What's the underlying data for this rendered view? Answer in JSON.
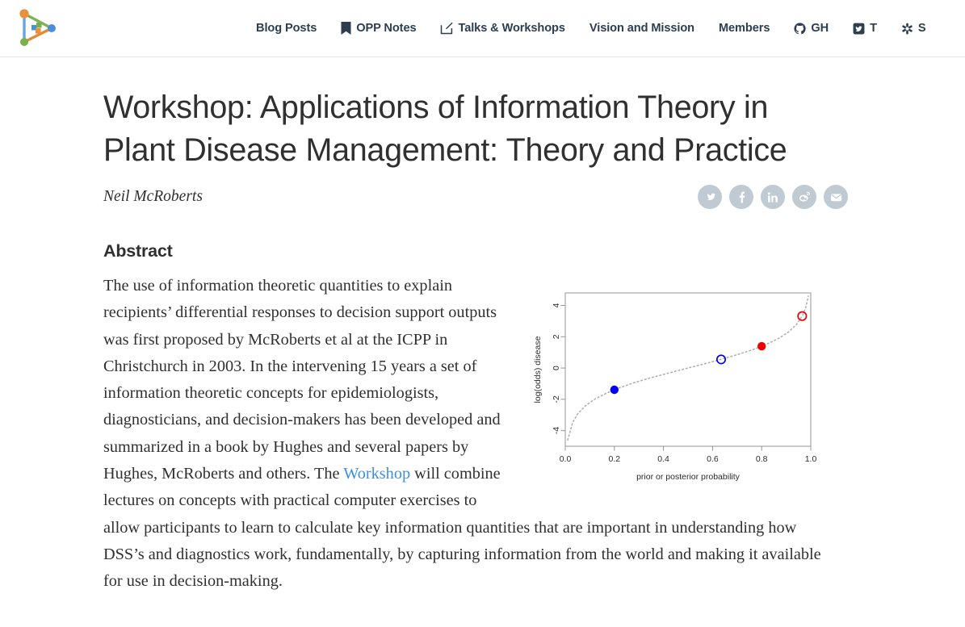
{
  "nav": {
    "brand_name": "site-logo",
    "items": [
      {
        "label": "Blog Posts",
        "icon": ""
      },
      {
        "label": "OPP Notes",
        "icon": "bookmark-icon"
      },
      {
        "label": "Talks & Workshops",
        "icon": "pencil-square-icon"
      },
      {
        "label": "Vision and Mission",
        "icon": ""
      },
      {
        "label": "Members",
        "icon": ""
      },
      {
        "label": "GH",
        "icon": "github-icon"
      },
      {
        "label": "T",
        "icon": "twitter-icon"
      },
      {
        "label": "S",
        "icon": "keybase-icon"
      }
    ]
  },
  "post": {
    "title": "Workshop: Applications of Information Theory in Plant Disease Management: Theory and Practice",
    "author": "Neil McRoberts",
    "share": [
      {
        "name": "twitter-share",
        "label": "Twitter"
      },
      {
        "name": "facebook-share",
        "label": "Facebook"
      },
      {
        "name": "linkedin-share",
        "label": "LinkedIn"
      },
      {
        "name": "weibo-share",
        "label": "Weibo"
      },
      {
        "name": "email-share",
        "label": "Email"
      }
    ]
  },
  "abstract": {
    "heading": "Abstract",
    "part1": "The use of information theoretic quantities to explain recipients’ differential responses to decision support outputs was first proposed by McRoberts et al at the ICPP in Christchurch in 2003. In the intervening 15 years a set of information theoretic concepts for epidemiologists, diagnosticians, and decision-makers has been developed and summarized in a book by Hughes and several papers by Hughes, McRoberts and others. The ",
    "link_text": "Workshop",
    "part2": " will combine lectures on concepts with practical computer exercises to allow participants to learn to calculate key information quantities that are important in understanding how DSS’s and diagnostics work, fundamentally, by capturing information from the world and making it available for use in decision-making."
  },
  "colors": {
    "link": "#3d8fdd",
    "nav_text": "#2c3e50",
    "body_text": "#303030",
    "share_bg": "#bfcad3",
    "logo_orange": "#e8913a",
    "logo_green": "#78b14b",
    "logo_blue": "#4a90d9"
  },
  "chart_data": {
    "type": "line",
    "title": "",
    "xlabel": "prior or posterior probability",
    "ylabel": "log(odds) disease",
    "xlim": [
      0.0,
      1.0
    ],
    "ylim": [
      -5.0,
      4.8
    ],
    "xticks": [
      "0.0",
      "0.2",
      "0.4",
      "0.6",
      "0.8",
      "1.0"
    ],
    "xtick_values": [
      0.0,
      0.2,
      0.4,
      0.6,
      0.8,
      1.0
    ],
    "yticks": [
      "4",
      "2",
      "0",
      "-2",
      "-4"
    ],
    "ytick_values": [
      4,
      2,
      0,
      -2,
      -4
    ],
    "grid": false,
    "legend": "none",
    "curve": {
      "name": "logit curve",
      "style": "dotted",
      "color": "#b0b0b0",
      "x": [
        0.01,
        0.03,
        0.05,
        0.08,
        0.12,
        0.17,
        0.22,
        0.28,
        0.34,
        0.4,
        0.46,
        0.52,
        0.58,
        0.64,
        0.7,
        0.76,
        0.82,
        0.87,
        0.91,
        0.94,
        0.965,
        0.98,
        0.99
      ],
      "y": [
        -4.6,
        -3.48,
        -2.94,
        -2.44,
        -1.99,
        -1.59,
        -1.27,
        -0.94,
        -0.66,
        -0.41,
        -0.16,
        0.08,
        0.32,
        0.58,
        0.85,
        1.15,
        1.52,
        1.9,
        2.31,
        2.75,
        3.32,
        3.89,
        4.6
      ]
    },
    "points": [
      {
        "name": "prior-negative",
        "x": 0.2,
        "y": -1.39,
        "color": "#0000ee",
        "filled": true,
        "label": "blue filled"
      },
      {
        "name": "posterior-negative",
        "x": 0.635,
        "y": 0.55,
        "color": "#0000ee",
        "filled": false,
        "label": "blue open"
      },
      {
        "name": "prior-positive",
        "x": 0.8,
        "y": 1.39,
        "color": "#ee0000",
        "filled": true,
        "label": "red filled"
      },
      {
        "name": "posterior-positive",
        "x": 0.965,
        "y": 3.32,
        "color": "#ee0000",
        "filled": false,
        "label": "red open"
      }
    ]
  }
}
